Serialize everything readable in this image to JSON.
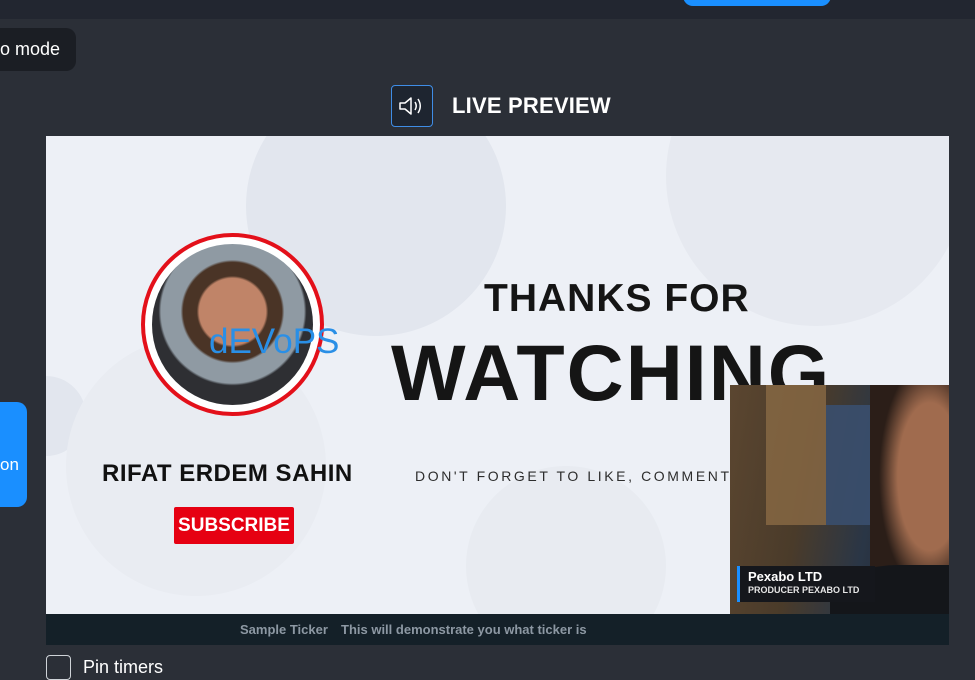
{
  "top_bar": {
    "accent_button_label": ""
  },
  "mode_toggle": {
    "label": "o mode"
  },
  "side_button": {
    "label": "on"
  },
  "preview": {
    "title": "LIVE PREVIEW",
    "speaker_icon": "speaker-icon"
  },
  "scene": {
    "avatar_overlay_text": "dEVoPS",
    "person_name": "RIFAT ERDEM SAHIN",
    "subscribe_label": "SUBSCRIBE",
    "headline_line1": "THANKS FOR",
    "headline_line2": "WATCHING",
    "tagline": "DON'T FORGET TO LIKE, COMMENT A"
  },
  "camera": {
    "name": "Pexabo LTD",
    "role": "PRODUCER PEXABO LTD"
  },
  "ticker": {
    "title": "Sample Ticker",
    "text": "This will demonstrate you what ticker is"
  },
  "pin_timers": {
    "label": "Pin timers",
    "checked": false
  },
  "colors": {
    "accent": "#1a8fff",
    "subscribe_red": "#e60012",
    "ring_red": "#e3101a",
    "background": "#2b2f37"
  }
}
